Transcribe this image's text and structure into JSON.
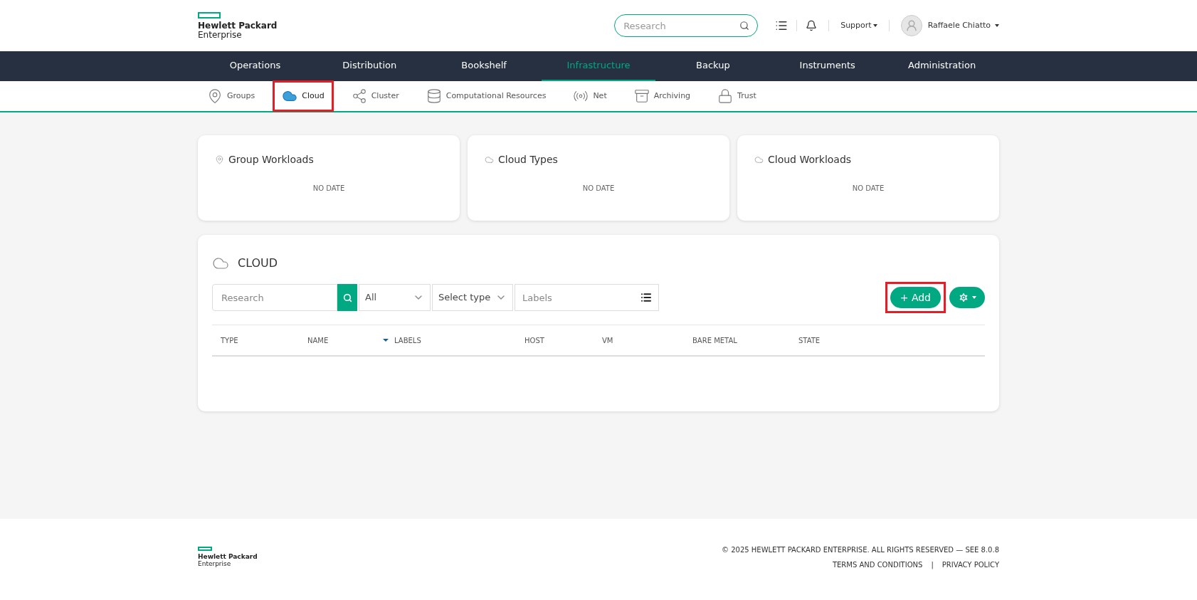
{
  "header": {
    "logo": [
      "Hewlett Packard",
      "Enterprise"
    ],
    "search": {
      "placeholder": "Research"
    },
    "support": "Support",
    "user": "Raffaele Chiatto"
  },
  "nav": [
    {
      "label": "Operations",
      "selected": false
    },
    {
      "label": "Distribution",
      "selected": false
    },
    {
      "label": "Bookshelf",
      "selected": false
    },
    {
      "label": "Infrastructure",
      "selected": true
    },
    {
      "label": "Backup",
      "selected": false
    },
    {
      "label": "Instruments",
      "selected": false
    },
    {
      "label": "Administration",
      "selected": false
    }
  ],
  "subnav": [
    {
      "label": "Groups",
      "kind": "groups",
      "selected": false,
      "highlighted": false
    },
    {
      "label": "Cloud",
      "kind": "cloud",
      "selected": true,
      "highlighted": true
    },
    {
      "label": "Cluster",
      "kind": "cluster",
      "selected": false,
      "highlighted": false
    },
    {
      "label": "Computational Resources",
      "kind": "database",
      "selected": false,
      "highlighted": false
    },
    {
      "label": "Net",
      "kind": "antenna",
      "selected": false,
      "highlighted": false
    },
    {
      "label": "Archiving",
      "kind": "archive",
      "selected": false,
      "highlighted": false
    },
    {
      "label": "Trust",
      "kind": "lock",
      "selected": false,
      "highlighted": false
    }
  ],
  "widgets": [
    {
      "title": "Group Workloads",
      "kind": "groups",
      "message": "NO DATE"
    },
    {
      "title": "Cloud Types",
      "kind": "cloud",
      "message": "NO DATE"
    },
    {
      "title": "Cloud Workloads",
      "kind": "cloud",
      "message": "NO DATE"
    }
  ],
  "panel": {
    "title": "CLOUD",
    "search": {
      "placeholder": "Research"
    },
    "filter": "All",
    "type_select": "Select type",
    "labels": {
      "placeholder": "Labels"
    },
    "add_button": {
      "label": "+ Add",
      "highlighted": true
    },
    "columns": [
      {
        "label": "TYPE",
        "sorted": false
      },
      {
        "label": "NAME",
        "sorted": false
      },
      {
        "label": "LABELS",
        "sorted": true
      },
      {
        "label": "HOST",
        "sorted": false
      },
      {
        "label": "VM",
        "sorted": false
      },
      {
        "label": "BARE METAL",
        "sorted": false
      },
      {
        "label": "STATE",
        "sorted": false
      }
    ]
  },
  "footer": {
    "logo": [
      "Hewlett Packard",
      "Enterprise"
    ],
    "copyright": "© 2025 HEWLETT PACKARD ENTERPRISE. ALL RIGHTS RESERVED — SEE 8.0.8",
    "links": [
      "TERMS AND CONDITIONS",
      "PRIVACY POLICY"
    ],
    "separator": "|"
  }
}
